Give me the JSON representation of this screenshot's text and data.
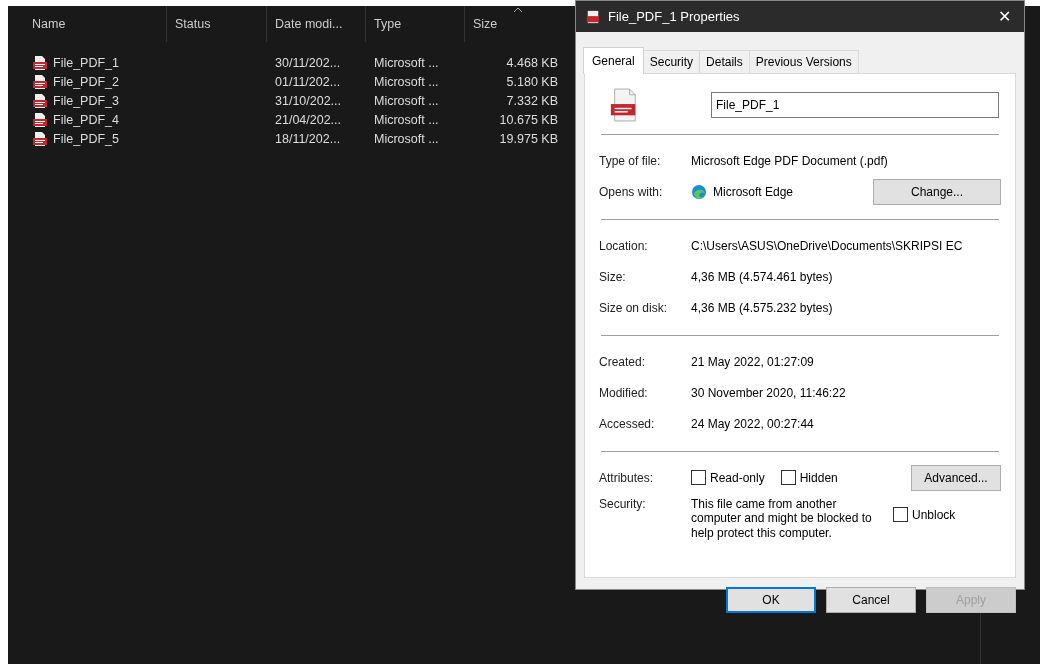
{
  "explorer": {
    "columns": [
      {
        "label": "Name",
        "sorted": false
      },
      {
        "label": "Status",
        "sorted": false
      },
      {
        "label": "Date modi...",
        "sorted": false
      },
      {
        "label": "Type",
        "sorted": false
      },
      {
        "label": "Size",
        "sorted": true
      }
    ],
    "rows": [
      {
        "name": "File_PDF_1",
        "date": "30/11/202...",
        "type": "Microsoft ...",
        "size": "4.468 KB"
      },
      {
        "name": "File_PDF_2",
        "date": "01/11/202...",
        "type": "Microsoft ...",
        "size": "5.180 KB"
      },
      {
        "name": "File_PDF_3",
        "date": "31/10/202...",
        "type": "Microsoft ...",
        "size": "7.332 KB"
      },
      {
        "name": "File_PDF_4",
        "date": "21/04/202...",
        "type": "Microsoft ...",
        "size": "10.675 KB"
      },
      {
        "name": "File_PDF_5",
        "date": "18/11/202...",
        "type": "Microsoft ...",
        "size": "19.975 KB"
      }
    ]
  },
  "dialog": {
    "title": "File_PDF_1 Properties",
    "close": "✕",
    "tabs": [
      {
        "label": "General",
        "selected": true
      },
      {
        "label": "Security",
        "selected": false
      },
      {
        "label": "Details",
        "selected": false
      },
      {
        "label": "Previous Versions",
        "selected": false
      }
    ],
    "file_name": "File_PDF_1",
    "type_of_file": {
      "label": "Type of file:",
      "value": "Microsoft Edge PDF Document (.pdf)"
    },
    "opens_with": {
      "label": "Opens with:",
      "value": "Microsoft Edge",
      "button": "Change..."
    },
    "info": [
      {
        "label": "Location:",
        "value": "C:\\Users\\ASUS\\OneDrive\\Documents\\SKRIPSI EC"
      },
      {
        "label": "Size:",
        "value": "4,36 MB (4.574.461 bytes)"
      },
      {
        "label": "Size on disk:",
        "value": "4,36 MB (4.575.232 bytes)"
      }
    ],
    "dates": [
      {
        "label": "Created:",
        "value": "21 May 2022, 01:27:09"
      },
      {
        "label": "Modified:",
        "value": "30 November 2020, 11:46:22"
      },
      {
        "label": "Accessed:",
        "value": "24 May 2022, 00:27:44"
      }
    ],
    "attributes": {
      "label": "Attributes:",
      "checkboxes": [
        {
          "label": "Read-only",
          "checked": false
        },
        {
          "label": "Hidden",
          "checked": false
        }
      ],
      "button": "Advanced..."
    },
    "security": {
      "label": "Security:",
      "text": "This file came from another computer and might be blocked to help protect this computer.",
      "unblock": {
        "label": "Unblock",
        "checked": false
      }
    },
    "buttons": [
      {
        "label": "OK",
        "default": true,
        "disabled": false
      },
      {
        "label": "Cancel",
        "default": false,
        "disabled": false
      },
      {
        "label": "Apply",
        "default": false,
        "disabled": true
      }
    ]
  }
}
